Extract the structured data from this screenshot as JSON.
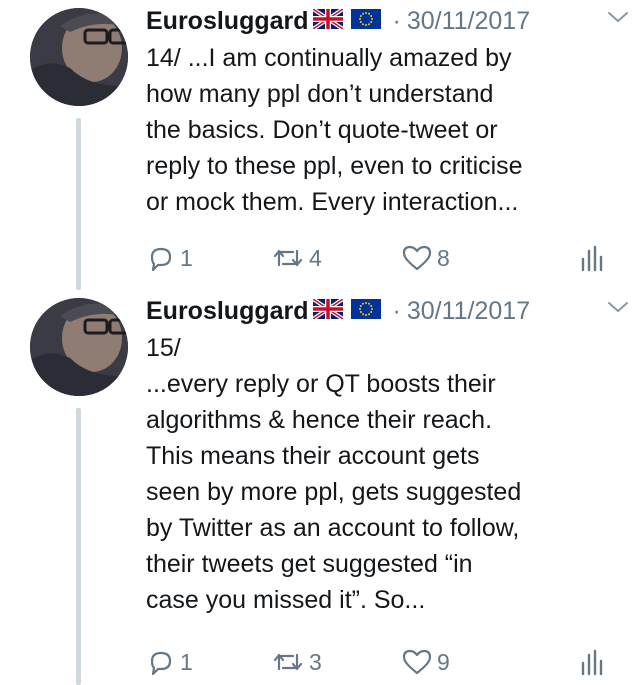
{
  "tweets": [
    {
      "author": "Eurosluggard",
      "separator": "·",
      "date": "30/11/2017",
      "text": "14/ ...I am continually amazed by\nhow many ppl don’t understand\nthe basics. Don’t quote-tweet or\nreply to these ppl, even to criticise\nor mock them.  Every interaction...",
      "replies": "1",
      "retweets": "4",
      "likes": "8"
    },
    {
      "author": "Eurosluggard",
      "separator": "·",
      "date": "30/11/2017",
      "text": "15/\n...every reply or QT boosts their\nalgorithms & hence their reach.\nThis means their account gets\nseen by more ppl, gets suggested\nby Twitter as an account to follow,\ntheir tweets get suggested “in\ncase you missed it”. So...",
      "replies": "1",
      "retweets": "3",
      "likes": "9"
    }
  ],
  "icons": {
    "flags": [
      "uk-flag-icon",
      "eu-flag-icon"
    ],
    "caret": "chevron-down-icon",
    "reply": "reply-icon",
    "retweet": "retweet-icon",
    "like": "heart-icon",
    "stats": "analytics-icon"
  },
  "colors": {
    "text": "#14171a",
    "secondary": "#657786",
    "thread_line": "#cfd9de"
  }
}
